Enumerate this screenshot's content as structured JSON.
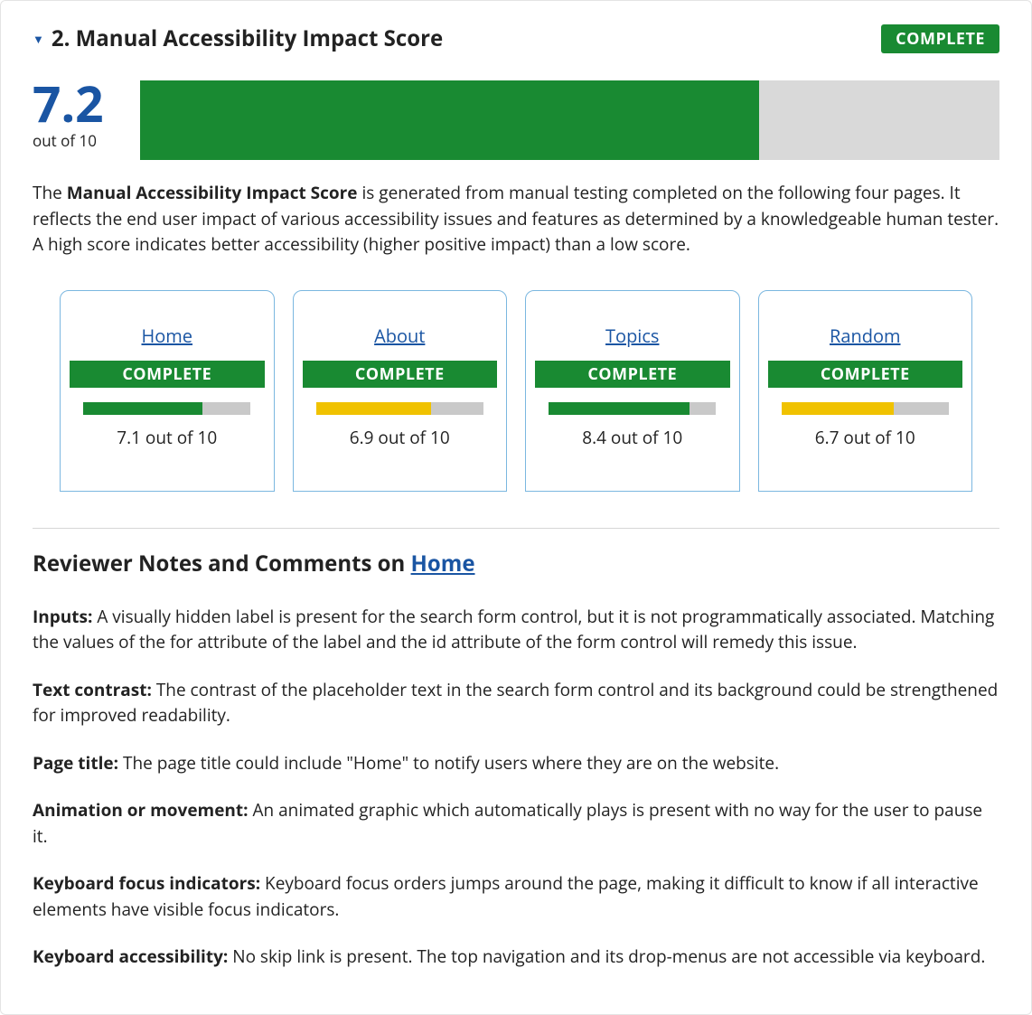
{
  "header": {
    "title": "2. Manual Accessibility Impact Score",
    "badge": "COMPLETE"
  },
  "score": {
    "value": "7.2",
    "outOf": "out of 10",
    "barPercent": 72
  },
  "description": {
    "boldTerm": "Manual Accessibility Impact Score",
    "prefix": "The ",
    "suffix": " is generated from manual testing completed on the following four pages. It reflects the end user impact of various accessibility issues and features as determined by a knowledgeable human tester. A high score indicates better accessibility (higher positive impact) than a low score."
  },
  "cards": [
    {
      "label": "Home",
      "status": "COMPLETE",
      "scoreText": "7.1 out of 10",
      "barPercent": 71,
      "barColor": "green"
    },
    {
      "label": "About",
      "status": "COMPLETE",
      "scoreText": "6.9 out of 10",
      "barPercent": 69,
      "barColor": "yellow"
    },
    {
      "label": "Topics",
      "status": "COMPLETE",
      "scoreText": "8.4 out of 10",
      "barPercent": 84,
      "barColor": "green"
    },
    {
      "label": "Random",
      "status": "COMPLETE",
      "scoreText": "6.7 out of 10",
      "barPercent": 67,
      "barColor": "yellow"
    }
  ],
  "notes": {
    "headingPrefix": "Reviewer Notes and Comments on ",
    "headingLink": "Home",
    "items": [
      {
        "label": "Inputs:",
        "text": " A visually hidden label is present for the search form control, but it is not programmatically associated. Matching the values of the for attribute of the label and the id attribute of the form control will remedy this issue."
      },
      {
        "label": "Text contrast:",
        "text": " The contrast of the placeholder text in the search form control and its background could be strengthened for improved readability."
      },
      {
        "label": "Page title:",
        "text": " The page title could include \"Home\" to notify users where they are on the website."
      },
      {
        "label": "Animation or movement:",
        "text": " An animated graphic which automatically plays is present with no way for the user to pause it."
      },
      {
        "label": "Keyboard focus indicators:",
        "text": " Keyboard focus orders jumps around the page, making it difficult to know if all interactive elements have visible focus indicators."
      },
      {
        "label": "Keyboard accessibility:",
        "text": " No skip link is present. The top navigation and its drop-menus are not accessible via keyboard."
      }
    ]
  },
  "chart_data": {
    "type": "bar",
    "title": "Manual Accessibility Impact Score",
    "overall": {
      "value": 7.2,
      "max": 10
    },
    "pages": {
      "categories": [
        "Home",
        "About",
        "Topics",
        "Random"
      ],
      "values": [
        7.1,
        6.9,
        8.4,
        6.7
      ],
      "max": 10
    },
    "ylim": [
      0,
      10
    ]
  }
}
